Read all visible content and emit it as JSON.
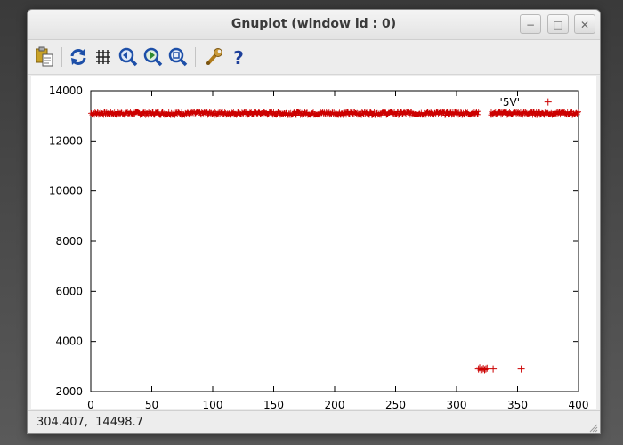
{
  "window": {
    "title": "Gnuplot (window id : 0)"
  },
  "window_controls": {
    "minimize": "−",
    "maximize": "□",
    "close": "✕"
  },
  "toolbar": {
    "items": [
      {
        "name": "copy-to-clipboard-icon"
      },
      {
        "name": "replot-icon"
      },
      {
        "name": "toggle-grid-icon"
      },
      {
        "name": "previous-zoom-icon"
      },
      {
        "name": "next-zoom-icon"
      },
      {
        "name": "autoscale-icon"
      },
      {
        "name": "options-wrench-icon"
      },
      {
        "name": "help-icon"
      }
    ]
  },
  "status": {
    "coords": "304.407,  14498.7"
  },
  "colors": {
    "series": "#cc0000",
    "axis": "#000000"
  },
  "chart_data": {
    "type": "scatter",
    "title": "",
    "xlabel": "",
    "ylabel": "",
    "xlim": [
      0,
      400
    ],
    "ylim": [
      2000,
      14000
    ],
    "xticks": [
      0,
      50,
      100,
      150,
      200,
      250,
      300,
      350,
      400
    ],
    "yticks": [
      2000,
      4000,
      6000,
      8000,
      10000,
      12000,
      14000
    ],
    "grid": false,
    "legend": {
      "position": "top-right",
      "entries": [
        "'5V'"
      ]
    },
    "series": [
      {
        "name": "'5V'",
        "marker": "+",
        "color": "#cc0000",
        "band": {
          "x_start": 0,
          "x_end": 400,
          "x_step": 0.5,
          "y_center": 13100,
          "y_spread": 80,
          "gap_x": [
            318,
            328
          ]
        },
        "outliers": [
          {
            "x": 318,
            "y": 2900
          },
          {
            "x": 319,
            "y": 2950
          },
          {
            "x": 320,
            "y": 2850
          },
          {
            "x": 321,
            "y": 2880
          },
          {
            "x": 322,
            "y": 2920
          },
          {
            "x": 323,
            "y": 2870
          },
          {
            "x": 324,
            "y": 2900
          },
          {
            "x": 325,
            "y": 2930
          },
          {
            "x": 330,
            "y": 2900
          },
          {
            "x": 353,
            "y": 2900
          },
          {
            "x": 375,
            "y": 13550
          }
        ]
      }
    ]
  }
}
